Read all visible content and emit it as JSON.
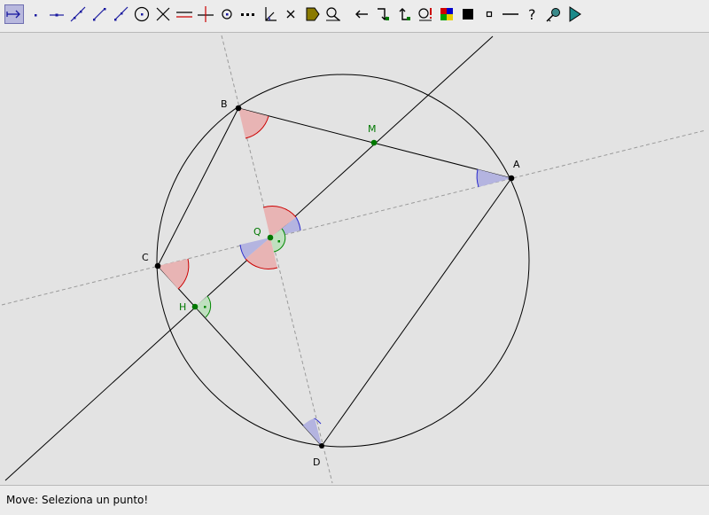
{
  "toolbar": {
    "tools": [
      {
        "id": "move",
        "icon": "move-arrow-icon",
        "active": true
      },
      {
        "id": "point",
        "icon": "point-icon"
      },
      {
        "id": "point-on-line",
        "icon": "point-on-line-icon"
      },
      {
        "id": "line",
        "icon": "line-icon"
      },
      {
        "id": "segment",
        "icon": "segment-icon"
      },
      {
        "id": "ray",
        "icon": "ray-icon"
      },
      {
        "id": "circle",
        "icon": "circle-center-icon"
      },
      {
        "id": "intersect",
        "icon": "intersect-icon"
      },
      {
        "id": "parallel",
        "icon": "parallel-line-icon"
      },
      {
        "id": "perpendicular",
        "icon": "perpendicular-line-icon"
      },
      {
        "id": "midpoint",
        "icon": "midpoint-icon"
      },
      {
        "id": "dotted",
        "icon": "dotted-line-icon"
      },
      {
        "id": "angle",
        "icon": "angle-icon"
      },
      {
        "id": "delete",
        "icon": "delete-x-icon"
      },
      {
        "id": "label",
        "icon": "label-tag-icon"
      },
      {
        "id": "magnify",
        "icon": "magnify-icon"
      },
      {
        "id": "undo",
        "icon": "undo-arrow-icon"
      },
      {
        "id": "redo1",
        "icon": "redo-arrow-icon"
      },
      {
        "id": "redo2",
        "icon": "back-arrow-icon"
      },
      {
        "id": "warning",
        "icon": "warning-magnify-icon"
      },
      {
        "id": "palette",
        "icon": "color-palette-icon"
      },
      {
        "id": "fill-square",
        "icon": "filled-square-icon"
      },
      {
        "id": "small-square",
        "icon": "small-square-icon"
      },
      {
        "id": "dash",
        "icon": "line-style-icon"
      },
      {
        "id": "help",
        "icon": "help-question-icon"
      },
      {
        "id": "key",
        "icon": "key-icon"
      },
      {
        "id": "play",
        "icon": "play-icon"
      }
    ]
  },
  "points": {
    "A": {
      "label": "A"
    },
    "B": {
      "label": "B"
    },
    "C": {
      "label": "C"
    },
    "D": {
      "label": "D"
    },
    "M": {
      "label": "M"
    },
    "Q": {
      "label": "Q"
    },
    "H": {
      "label": "H"
    }
  },
  "colors": {
    "toolbar_active": "#b8b8de",
    "canvas": "#e3e3e3",
    "point_black": "#000000",
    "point_green": "#007800",
    "angle_red_fill": "#e8b4b4",
    "angle_red_stroke": "#cc0000",
    "angle_blue_fill": "#b4b4e0",
    "angle_blue_stroke": "#2a2acc",
    "angle_green_fill": "#bfe0bf",
    "angle_green_stroke": "#008800",
    "dashed_line": "#9a9a9a"
  },
  "status": {
    "text": "Move: Seleziona un punto!"
  }
}
